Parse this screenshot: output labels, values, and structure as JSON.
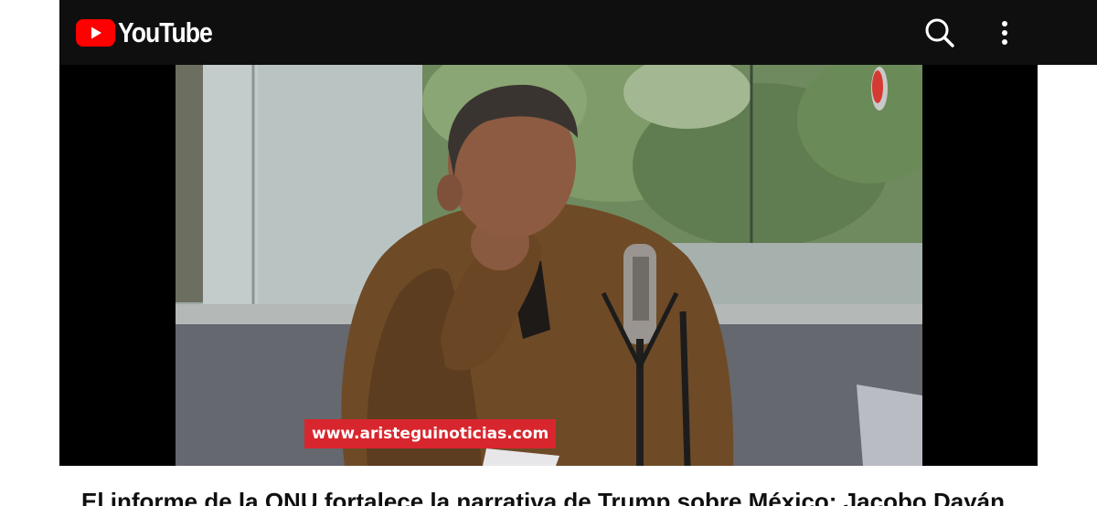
{
  "header": {
    "logo_text": "YouTube",
    "logo_color": "#ff0000",
    "search_icon": "search-icon",
    "more_icon": "more-vertical-icon",
    "background": "#0f0f0f"
  },
  "video": {
    "watermark_text": "www.aristeguinoticias.com",
    "watermark_color": "#d8262e",
    "title": "El informe de la ONU fortalece la narrativa de Trump sobre México: Jacobo Dayán"
  }
}
